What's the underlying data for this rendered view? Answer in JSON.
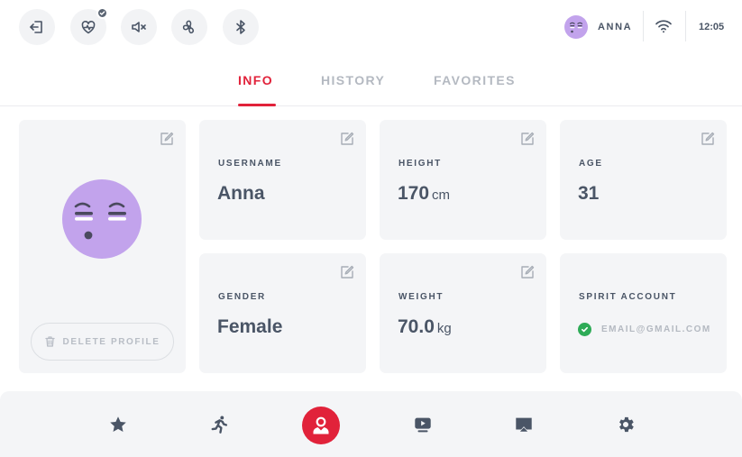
{
  "topbar": {
    "buttons": [
      {
        "icon": "exit-icon"
      },
      {
        "icon": "heart-rate-icon",
        "badge": "check-badge"
      },
      {
        "icon": "mute-icon"
      },
      {
        "icon": "fan-icon"
      },
      {
        "icon": "bluetooth-icon"
      }
    ],
    "user_name": "ANNA",
    "wifi_icon": "wifi-icon",
    "time": "12:05"
  },
  "tabs": [
    {
      "label": "INFO",
      "active": true
    },
    {
      "label": "HISTORY",
      "active": false
    },
    {
      "label": "FAVORITES",
      "active": false
    }
  ],
  "profile": {
    "avatar_icon": "emoji-avatar",
    "delete_label": "DELETE PROFILE"
  },
  "fields": {
    "username": {
      "label": "USERNAME",
      "value": "Anna"
    },
    "height": {
      "label": "HEIGHT",
      "value": "170",
      "unit": "cm"
    },
    "age": {
      "label": "AGE",
      "value": "31"
    },
    "gender": {
      "label": "GENDER",
      "value": "Female"
    },
    "weight": {
      "label": "WEIGHT",
      "value": "70.0",
      "unit": "kg"
    },
    "account": {
      "label": "SPIRIT ACCOUNT",
      "email": "EMAIL@GMAIL.COM"
    }
  },
  "bottom_nav": [
    {
      "icon": "star-icon"
    },
    {
      "icon": "running-icon"
    },
    {
      "icon": "user-icon",
      "active": true
    },
    {
      "icon": "video-icon"
    },
    {
      "icon": "cast-icon"
    },
    {
      "icon": "gear-icon"
    }
  ],
  "colors": {
    "accent": "#e1223a",
    "text": "#4a5566",
    "muted": "#b4b9c1",
    "card_bg": "#f4f5f7",
    "avatar": "#c2a3ec",
    "success": "#2eab57"
  }
}
